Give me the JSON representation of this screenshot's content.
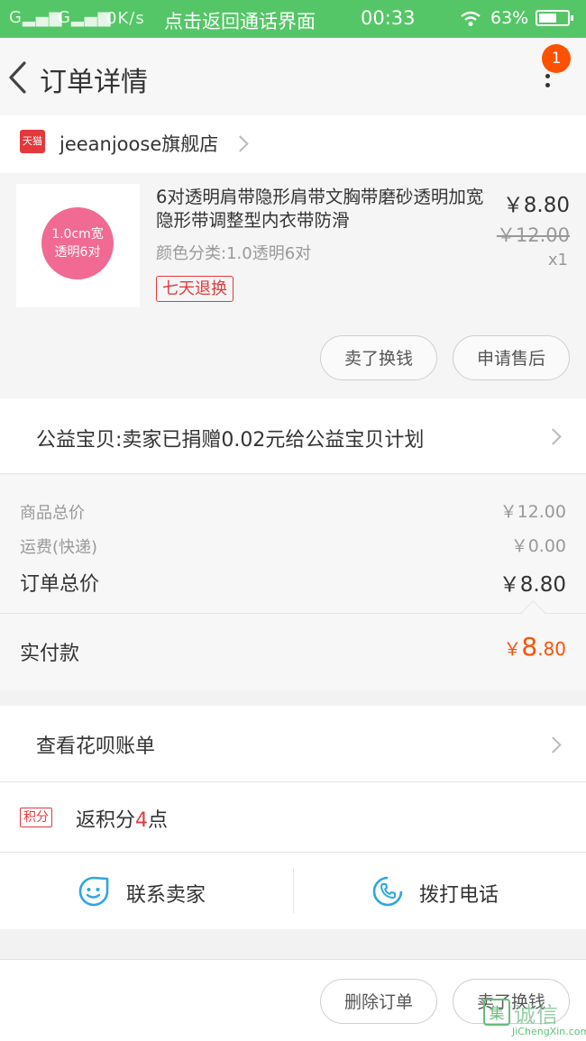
{
  "status_bar": {
    "signal_1": "G",
    "signal_2": "G",
    "speed": "0K/s",
    "center_text": "点击返回通话界面",
    "time": "00:33",
    "battery": "63%",
    "battery_level": 0.63
  },
  "nav": {
    "title": "订单详情",
    "badge_count": "1"
  },
  "store": {
    "logo_text": "天猫",
    "name": "jeeanjoose旗舰店"
  },
  "product": {
    "thumb_line1": "1.0cm宽",
    "thumb_line2": "透明6对",
    "title": "6对透明肩带隐形肩带文胸带磨砂透明加宽隐形带调整型内衣带防滑",
    "sku": "颜色分类:1.0透明6对",
    "tag": "七天退换",
    "price": "￥8.80",
    "original_price": "￥12.00",
    "quantity": "x1",
    "btn_sell": "卖了换钱",
    "btn_after_sale": "申请售后"
  },
  "charity": {
    "text": "公益宝贝:卖家已捐赠0.02元给公益宝贝计划"
  },
  "totals": {
    "goods_label": "商品总价",
    "goods_value": "￥12.00",
    "shipping_label": "运费(快递)",
    "shipping_value": "￥0.00",
    "order_label": "订单总价",
    "order_value": "￥8.80",
    "paid_label": "实付款",
    "paid_currency": "￥",
    "paid_int": "8",
    "paid_dec": ".80"
  },
  "huabei": {
    "text": "查看花呗账单"
  },
  "points": {
    "badge": "积分",
    "prefix": "返积分",
    "num": "4",
    "suffix": "点"
  },
  "contact": {
    "seller": "联系卖家",
    "phone": "拨打电话"
  },
  "bottom": {
    "delete": "删除订单",
    "sell": "卖了换钱"
  },
  "watermark": {
    "logo": "集",
    "cn": "诚信",
    "en": "JiChengXin.com"
  },
  "colors": {
    "status_green": "#55c667",
    "accent_orange": "#ff5000",
    "tmall_red": "#e4393c",
    "link_blue": "#2da7e0"
  }
}
